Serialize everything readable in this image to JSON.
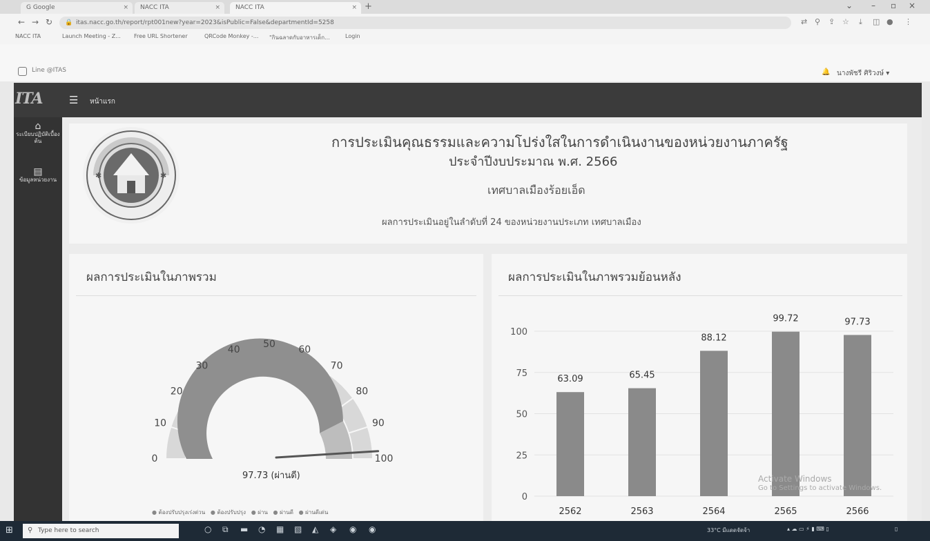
{
  "browser": {
    "tabs": [
      {
        "label": "G Google"
      },
      {
        "label": "NACC ITA"
      },
      {
        "label": "NACC ITA"
      }
    ],
    "url": "itas.nacc.go.th/report/rpt001new?year=2023&isPublic=False&departmentId=5258",
    "bookmarks": [
      "NACC ITA",
      "Launch Meeting - Z...",
      "Free URL Shortener",
      "QRCode Monkey -...",
      "\"กินฉลาดกับอาหารเด็ก...",
      "Login"
    ]
  },
  "page": {
    "line_label": "Line @ITAS",
    "user_name": "นางพัชรี ศิริวงษ์"
  },
  "nav": {
    "logo": "ITA",
    "home_label": "หน้าแรก"
  },
  "sidebar": {
    "items": [
      {
        "label": "ระเบียบปฏิบัติเบื้องต้น",
        "icon": "home-icon"
      },
      {
        "label": "ข้อมูลหน่วยงาน",
        "icon": "building-icon"
      }
    ]
  },
  "header": {
    "line1": "การประเมินคุณธรรมและความโปร่งใสในการดำเนินงานของหน่วยงานภาครัฐ",
    "line2": "ประจำปีงบประมาณ พ.ศ. 2566",
    "org_name": "เทศบาลเมืองร้อยเอ็ด",
    "rank_text": "ผลการประเมินอยู่ในลำดับที่ 24 ของหน่วยงานประเภท เทศบาลเมือง"
  },
  "panels": {
    "overall_title": "ผลการประเมินในภาพรวม",
    "history_title": "ผลการประเมินในภาพรวมย้อนหลัง"
  },
  "gauge": {
    "value": 97.73,
    "value_text": "97.73 (ผ่านดี)",
    "ticks": [
      0,
      10,
      20,
      30,
      40,
      50,
      60,
      70,
      80,
      90,
      100
    ],
    "legend": [
      "ต้องปรับปรุงเร่งด่วน",
      "ต้องปรับปรุง",
      "ผ่าน",
      "ผ่านดี",
      "ผ่านดีเด่น"
    ]
  },
  "chart_data": {
    "type": "bar",
    "categories": [
      "2562",
      "2563",
      "2564",
      "2565",
      "2566"
    ],
    "values": [
      63.09,
      65.45,
      88.12,
      99.72,
      97.73
    ],
    "ylim": [
      0,
      100
    ],
    "yticks": [
      0,
      25,
      50,
      75,
      100
    ],
    "bar_color": "#8a8a8a"
  },
  "taskbar": {
    "search_placeholder": "Type here to search",
    "weather": "33°C มีแดดจัดจ้า"
  },
  "watermark": {
    "line1": "Activate Windows",
    "line2": "Go to Settings to activate Windows."
  }
}
